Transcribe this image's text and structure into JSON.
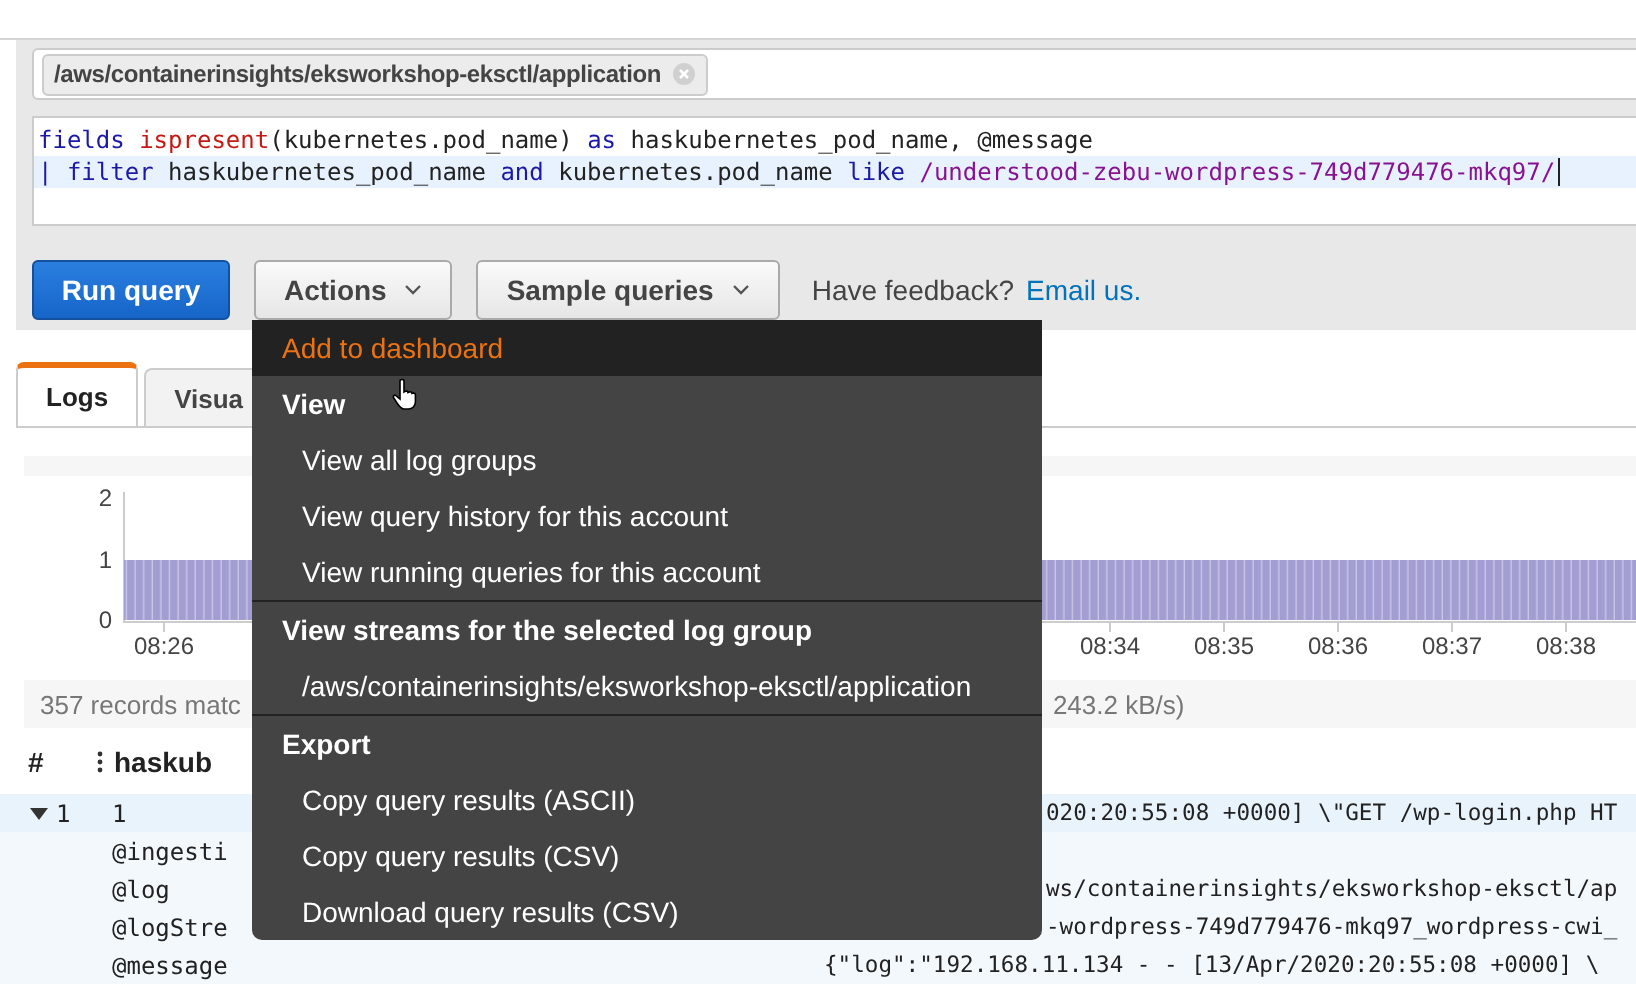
{
  "log_group": {
    "chip": "/aws/containerinsights/eksworkshop-eksctl/application"
  },
  "query_editor": {
    "lines": [
      {
        "active": false,
        "tokens": [
          {
            "kind": "keyword",
            "text": "fields "
          },
          {
            "kind": "function",
            "text": "ispresent"
          },
          {
            "kind": "plain",
            "text": "(kubernetes.pod_name) "
          },
          {
            "kind": "keyword",
            "text": "as"
          },
          {
            "kind": "plain",
            "text": " haskubernetes_pod_name, @message"
          }
        ]
      },
      {
        "active": true,
        "tokens": [
          {
            "kind": "keyword",
            "text": "| filter"
          },
          {
            "kind": "plain",
            "text": " haskubernetes_pod_name "
          },
          {
            "kind": "keyword",
            "text": "and"
          },
          {
            "kind": "plain",
            "text": " kubernetes.pod_name "
          },
          {
            "kind": "keyword",
            "text": "like"
          },
          {
            "kind": "regex",
            "text": " /understood-zebu-wordpress-749d779476-mkq97/"
          }
        ]
      }
    ]
  },
  "toolbar": {
    "run_button": "Run query",
    "actions_button": "Actions",
    "sample_button": "Sample queries",
    "feedback_text": "Have feedback?",
    "feedback_link": "Email us."
  },
  "tabs": [
    {
      "label": "Logs",
      "selected": true
    },
    {
      "label": "Visua",
      "selected": false
    }
  ],
  "histogram": {
    "y_ticks": [
      "2",
      "1",
      "0"
    ],
    "x_ticks": [
      "08:26",
      "08:34",
      "08:35",
      "08:36",
      "08:37",
      "08:38"
    ]
  },
  "summary": {
    "left": "357 records matc",
    "right": "243.2 kB/s)"
  },
  "table": {
    "columns": [
      "#",
      "haskub"
    ],
    "rows": [
      {
        "kind": "record",
        "number": "1",
        "field": "1",
        "value": "020:20:55:08 +0000] \\\"GET /wp-login.php HT",
        "clipped": true
      },
      {
        "kind": "field",
        "field": "@ingesti"
      },
      {
        "kind": "field",
        "field": "@log",
        "value": "ws/containerinsights/eksworkshop-eksctl/ap",
        "clipped": true
      },
      {
        "kind": "field",
        "field": "@logStre",
        "value": "-wordpress-749d779476-mkq97_wordpress-cwi_",
        "clipped": true
      },
      {
        "kind": "field",
        "field": "@message",
        "value": "{\"log\":\"192.168.11.134 - - [13/Apr/2020:20:55:08 +0000] \\",
        "clipped": false
      }
    ]
  },
  "actions_menu": {
    "sections": [
      {
        "items": [
          {
            "label": "Add to dashboard",
            "selected": true
          }
        ]
      },
      {
        "header": "View",
        "items": [
          {
            "label": "View all log groups",
            "selected": false
          },
          {
            "label": "View query history for this account",
            "selected": false
          },
          {
            "label": "View running queries for this account",
            "selected": false
          }
        ]
      },
      {
        "header": "View streams for the selected log group",
        "items": [
          {
            "label": "/aws/containerinsights/eksworkshop-eksctl/application",
            "selected": false
          }
        ]
      },
      {
        "header": "Export",
        "items": [
          {
            "label": "Copy query results (ASCII)",
            "selected": false
          },
          {
            "label": "Copy query results (CSV)",
            "selected": false
          },
          {
            "label": "Download query results (CSV)",
            "selected": false
          }
        ]
      }
    ]
  }
}
